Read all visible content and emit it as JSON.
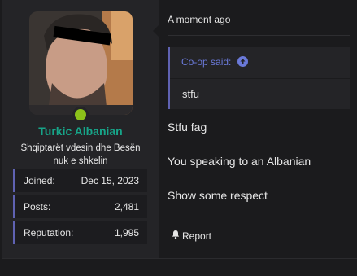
{
  "user": {
    "name": "Turkic Albanian",
    "title": "Shqiptarët vdesin dhe Besën nuk e shkelin",
    "stats": [
      {
        "label": "Joined:",
        "value": "Dec 15, 2023"
      },
      {
        "label": "Posts:",
        "value": "2,481"
      },
      {
        "label": "Reputation:",
        "value": "1,995"
      }
    ]
  },
  "post": {
    "time": "A moment ago",
    "quote": {
      "author": "Co-op said:",
      "text": "stfu"
    },
    "lines": [
      "Stfu fag",
      "You speaking to an Albanian",
      "Show some respect"
    ],
    "report_label": "Report"
  },
  "colors": {
    "username": "#17a589",
    "accent": "#5f62b2",
    "online": "#8cc21a",
    "quote_author": "#6a79d8"
  }
}
